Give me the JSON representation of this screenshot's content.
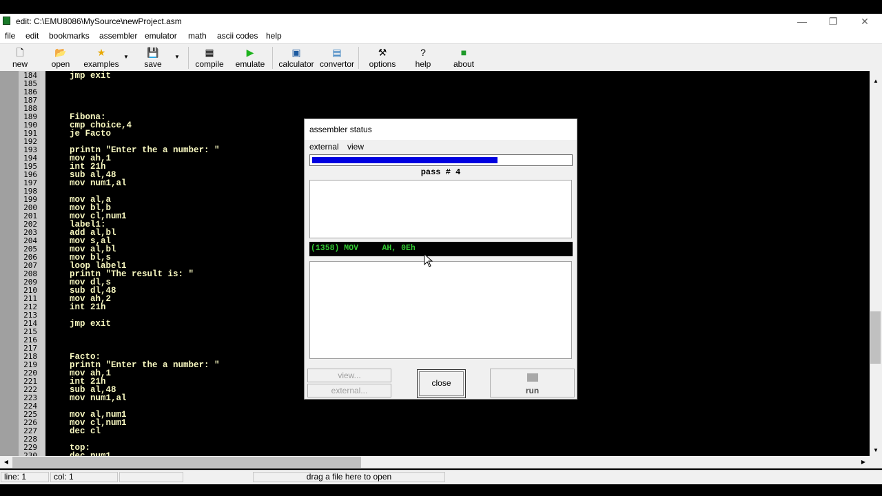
{
  "window": {
    "title": "edit: C:\\EMU8086\\MySource\\newProject.asm",
    "controls": {
      "minimize": "—",
      "restore": "❐",
      "close": "✕"
    }
  },
  "menu": [
    "file",
    "edit",
    "bookmarks",
    "assembler",
    "emulator",
    "math",
    "ascii codes",
    "help"
  ],
  "toolbar": {
    "new": "new",
    "open": "open",
    "examples": "examples",
    "save": "save",
    "compile": "compile",
    "emulate": "emulate",
    "calculator": "calculator",
    "convertor": "convertor",
    "options": "options",
    "help": "help",
    "about": "about"
  },
  "editor": {
    "lines": [
      {
        "n": "184",
        "code": "jmp exit"
      },
      {
        "n": "185",
        "code": ""
      },
      {
        "n": "186",
        "code": ""
      },
      {
        "n": "187",
        "code": ""
      },
      {
        "n": "188",
        "code": ""
      },
      {
        "n": "189",
        "code": "Fibona:"
      },
      {
        "n": "190",
        "code": "cmp choice,4"
      },
      {
        "n": "191",
        "code": "je Facto"
      },
      {
        "n": "192",
        "code": ""
      },
      {
        "n": "193",
        "code": "printn \"Enter the a number: \""
      },
      {
        "n": "194",
        "code": "mov ah,1"
      },
      {
        "n": "195",
        "code": "int 21h"
      },
      {
        "n": "196",
        "code": "sub al,48"
      },
      {
        "n": "197",
        "code": "mov num1,al"
      },
      {
        "n": "198",
        "code": ""
      },
      {
        "n": "199",
        "code": "mov al,a"
      },
      {
        "n": "200",
        "code": "mov bl,b"
      },
      {
        "n": "201",
        "code": "mov cl,num1"
      },
      {
        "n": "202",
        "code": "label1:"
      },
      {
        "n": "203",
        "code": "add al,bl"
      },
      {
        "n": "204",
        "code": "mov s,al"
      },
      {
        "n": "205",
        "code": "mov al,bl"
      },
      {
        "n": "206",
        "code": "mov bl,s"
      },
      {
        "n": "207",
        "code": "loop label1"
      },
      {
        "n": "208",
        "code": "printn \"The result is: \""
      },
      {
        "n": "209",
        "code": "mov dl,s"
      },
      {
        "n": "210",
        "code": "sub dl,48"
      },
      {
        "n": "211",
        "code": "mov ah,2"
      },
      {
        "n": "212",
        "code": "int 21h"
      },
      {
        "n": "213",
        "code": ""
      },
      {
        "n": "214",
        "code": "jmp exit"
      },
      {
        "n": "215",
        "code": ""
      },
      {
        "n": "216",
        "code": ""
      },
      {
        "n": "217",
        "code": ""
      },
      {
        "n": "218",
        "code": "Facto:"
      },
      {
        "n": "219",
        "code": "printn \"Enter the a number: \""
      },
      {
        "n": "220",
        "code": "mov ah,1"
      },
      {
        "n": "221",
        "code": "int 21h"
      },
      {
        "n": "222",
        "code": "sub al,48"
      },
      {
        "n": "223",
        "code": "mov num1,al"
      },
      {
        "n": "224",
        "code": ""
      },
      {
        "n": "225",
        "code": "mov al,num1"
      },
      {
        "n": "226",
        "code": "mov cl,num1"
      },
      {
        "n": "227",
        "code": "dec cl"
      },
      {
        "n": "228",
        "code": ""
      },
      {
        "n": "229",
        "code": "top:"
      },
      {
        "n": "230",
        "code": "dec num1"
      }
    ]
  },
  "statusbar": {
    "line": "line: 1",
    "col": "col: 1",
    "empty": "",
    "drop_hint": "drag a file here to open"
  },
  "dialog": {
    "title": "assembler status",
    "menu_external": "external",
    "menu_view": "view",
    "progress_fraction": 0.72,
    "pass_text": "pass # 4",
    "instruction": "(1358) MOV     AH, 0Eh",
    "view_button": "view...",
    "external_button": "external...",
    "close_button": "close",
    "run_button": "run"
  },
  "colors": {
    "progress": "#0000e0",
    "instruction_text": "#33cc33",
    "code_text": "#f8f8c0",
    "register_text": "#8ce0ff"
  }
}
